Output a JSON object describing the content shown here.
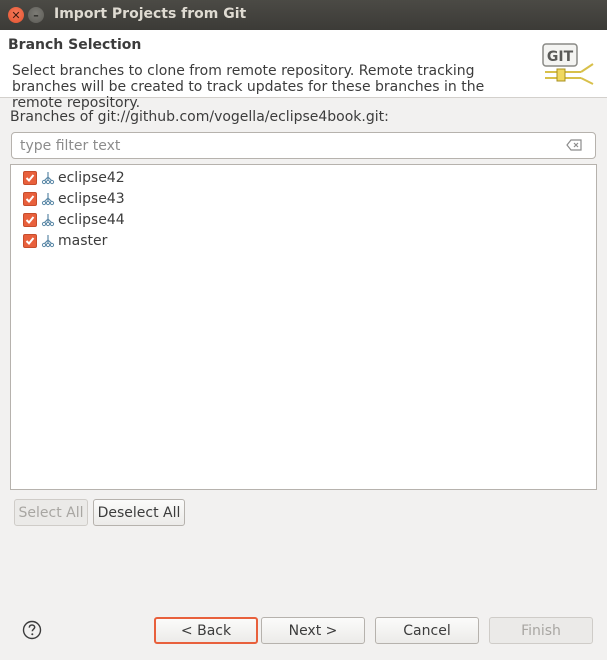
{
  "window": {
    "title": "Import Projects from Git",
    "close_icon": "close-icon",
    "minimize_icon": "minimize-icon"
  },
  "header": {
    "title": "Branch Selection",
    "description": "Select branches to clone from remote repository. Remote tracking branches will be created to track updates for these branches in the remote repository.",
    "logo_text": "GIT"
  },
  "branches_label": "Branches of git://github.com/vogella/eclipse4book.git:",
  "filter": {
    "placeholder": "type filter text",
    "value": ""
  },
  "branches": [
    {
      "name": "eclipse42",
      "checked": true
    },
    {
      "name": "eclipse43",
      "checked": true
    },
    {
      "name": "eclipse44",
      "checked": true
    },
    {
      "name": "master",
      "checked": true
    }
  ],
  "selection_buttons": {
    "select_all": "Select All",
    "deselect_all": "Deselect All"
  },
  "footer": {
    "back": "< Back",
    "next": "Next >",
    "cancel": "Cancel",
    "finish": "Finish"
  },
  "colors": {
    "accent": "#e8603c",
    "titlebar": "#3c3b37",
    "background": "#f2f1f0"
  }
}
